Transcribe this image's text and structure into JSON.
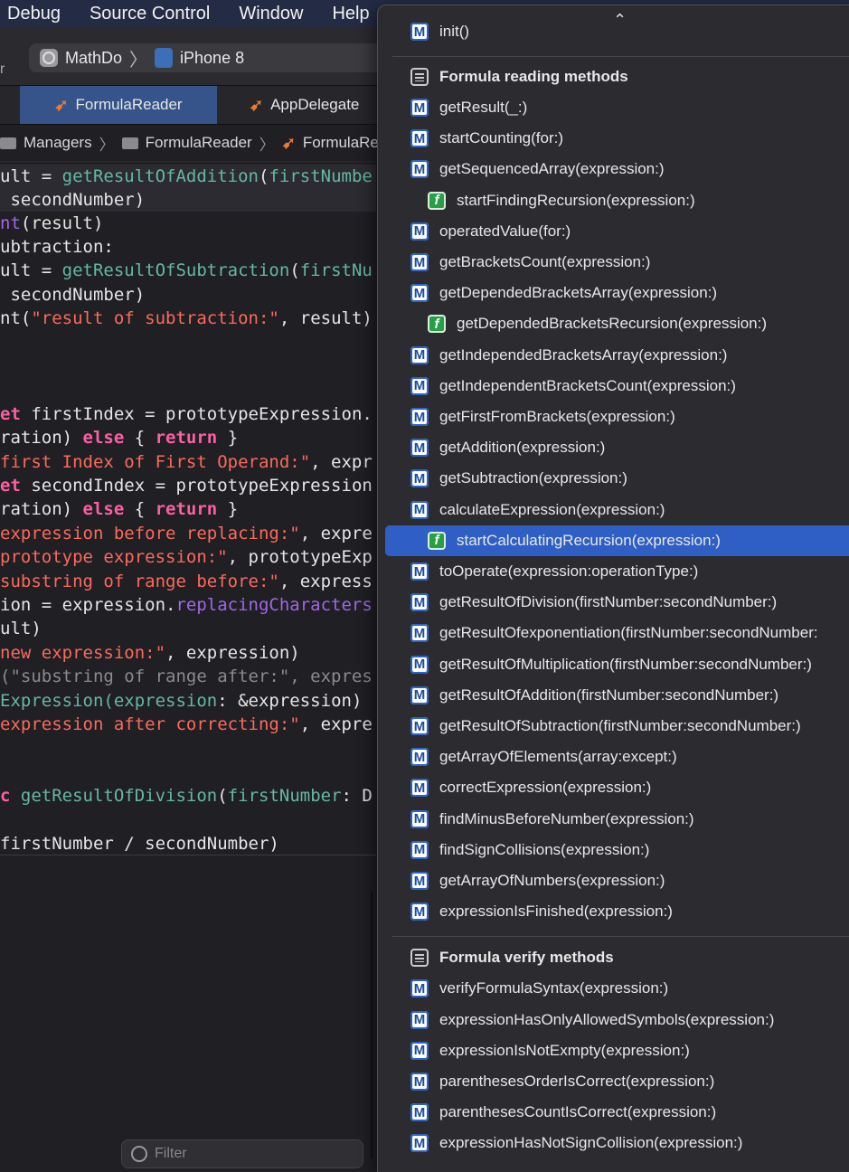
{
  "menubar": {
    "items": [
      "Debug",
      "Source Control",
      "Window",
      "Help"
    ]
  },
  "toolbar": {
    "scheme": "MathDo",
    "device": "iPhone 8",
    "left_glyph": "r"
  },
  "tabs": [
    {
      "label": "FormulaReader"
    },
    {
      "label": "AppDelegate"
    }
  ],
  "breadcrumb": [
    "Managers",
    "FormulaReader",
    "FormulaRea"
  ],
  "code": {
    "l1a": "ult = ",
    "l1b": "getResultOfAddition",
    "l1c": "(",
    "l1d": "firstNumbe",
    "l2": " secondNumber)",
    "l3a": "nt",
    "l3b": "(result)",
    "l4": "ubtraction:",
    "l5a": "ult = ",
    "l5b": "getResultOfSubtraction",
    "l5c": "(",
    "l5d": "firstNu",
    "l6": " secondNumber)",
    "l7a": "nt(",
    "l7b": "\"result of subtraction:\"",
    "l7c": ", result)",
    "l8a": "et",
    "l8b": " firstIndex = prototypeExpression.",
    "l9a": "ration) ",
    "l9b": "else",
    "l9c": " { ",
    "l9d": "return",
    "l9e": " }",
    "l10a": "first Index of First Operand:\"",
    "l10b": ", expr",
    "l11a": "et",
    "l11b": " secondIndex = prototypeExpression",
    "l12a": "ration) ",
    "l12b": "else",
    "l12c": " { ",
    "l12d": "return",
    "l12e": " }",
    "l13a": "expression before replacing:\"",
    "l13b": ", expre",
    "l14a": "prototype expression:\"",
    "l14b": ", prototypeExp",
    "l15a": "substring of range before:\"",
    "l15b": ", express",
    "l16a": "ion = expression.",
    "l16b": "replacingCharacters",
    "l17": "ult)",
    "l18a": "new expression:\"",
    "l18b": ", expression)",
    "l19": "(\"substring of range after:\", expres",
    "l20a": "Expression(",
    "l20b": "expression",
    "l20c": ": &expression)",
    "l21a": "expression after correcting:\"",
    "l21b": ", expre",
    "l22a": "c ",
    "l22b": "getResultOfDivision",
    "l22c": "(",
    "l22d": "firstNumber",
    "l22e": ": D",
    "l23": "firstNumber / secondNumber)"
  },
  "filter": {
    "placeholder": "Filter"
  },
  "popup": {
    "partial_top": "init()",
    "section1_title": "Formula reading methods",
    "section1_items": [
      {
        "badge": "M",
        "label": "getResult(_:)"
      },
      {
        "badge": "M",
        "label": "startCounting(for:)"
      },
      {
        "badge": "M",
        "label": "getSequencedArray(expression:)"
      },
      {
        "badge": "f",
        "label": "startFindingRecursion(expression:)"
      },
      {
        "badge": "M",
        "label": "operatedValue(for:)"
      },
      {
        "badge": "M",
        "label": "getBracketsCount(expression:)"
      },
      {
        "badge": "M",
        "label": "getDependedBracketsArray(expression:)"
      },
      {
        "badge": "f",
        "label": "getDependedBracketsRecursion(expression:)"
      },
      {
        "badge": "M",
        "label": "getIndependedBracketsArray(expression:)"
      },
      {
        "badge": "M",
        "label": "getIndependentBracketsCount(expression:)"
      },
      {
        "badge": "M",
        "label": "getFirstFromBrackets(expression:)"
      },
      {
        "badge": "M",
        "label": "getAddition(expression:)"
      },
      {
        "badge": "M",
        "label": "getSubtraction(expression:)"
      },
      {
        "badge": "M",
        "label": "calculateExpression(expression:)"
      },
      {
        "badge": "f",
        "label": "startCalculatingRecursion(expression:)",
        "selected": true
      },
      {
        "badge": "M",
        "label": "toOperate(expression:operationType:)"
      },
      {
        "badge": "M",
        "label": "getResultOfDivision(firstNumber:secondNumber:)"
      },
      {
        "badge": "M",
        "label": "getResultOfexponentiation(firstNumber:secondNumber:"
      },
      {
        "badge": "M",
        "label": "getResultOfMultiplication(firstNumber:secondNumber:)"
      },
      {
        "badge": "M",
        "label": "getResultOfAddition(firstNumber:secondNumber:)"
      },
      {
        "badge": "M",
        "label": "getResultOfSubtraction(firstNumber:secondNumber:)"
      },
      {
        "badge": "M",
        "label": "getArrayOfElements(array:except:)"
      },
      {
        "badge": "M",
        "label": "correctExpression(expression:)"
      },
      {
        "badge": "M",
        "label": "findMinusBeforeNumber(expression:)"
      },
      {
        "badge": "M",
        "label": "findSignCollisions(expression:)"
      },
      {
        "badge": "M",
        "label": "getArrayOfNumbers(expression:)"
      },
      {
        "badge": "M",
        "label": "expressionIsFinished(expression:)"
      }
    ],
    "section2_title": "Formula verify methods",
    "section2_items": [
      {
        "badge": "M",
        "label": "verifyFormulaSyntax(expression:)"
      },
      {
        "badge": "M",
        "label": "expressionHasOnlyAllowedSymbols(expression:)"
      },
      {
        "badge": "M",
        "label": "expressionIsNotExmpty(expression:)"
      },
      {
        "badge": "M",
        "label": "parenthesesOrderIsCorrect(expression:)"
      },
      {
        "badge": "M",
        "label": "parenthesesCountIsCorrect(expression:)"
      },
      {
        "badge": "M",
        "label": "expressionHasNotSignCollision(expression:)"
      }
    ]
  }
}
